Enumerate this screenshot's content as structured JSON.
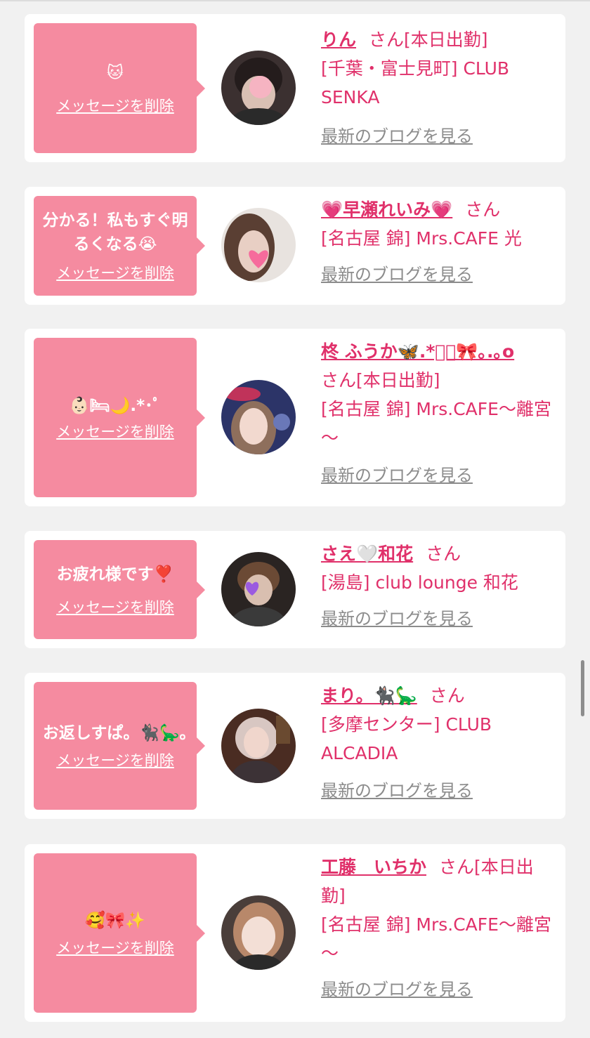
{
  "delete_label": "メッセージを削除",
  "blog_label": "最新のブログを見る",
  "colors": {
    "accent": "#e0306a",
    "bubble": "#f58ba0",
    "muted": "#8c8c8c",
    "background": "#f1f1f1"
  },
  "items": [
    {
      "message": "🐱",
      "name": "りん",
      "san": "さん[本日出勤]",
      "shop": "[千葉・富士見町] CLUB SENKA",
      "avatar_icon": "avatar-photo"
    },
    {
      "message": "分かる！私もすぐ明るくなる😭",
      "name": "💗早瀬れいみ💗",
      "san": "さん",
      "shop": "[名古屋 錦] Mrs.CAFE 光",
      "avatar_icon": "avatar-photo"
    },
    {
      "message": "👶🏻🛏🌙.*･ﾟ",
      "name": "柊 ふうか🦋.*ﾟ︵🎀｡.｡o",
      "san": "さん[本日出勤]",
      "shop": "[名古屋 錦] Mrs.CAFE～離宮～",
      "avatar_icon": "avatar-photo"
    },
    {
      "message": "お疲れ様です❣️",
      "name": "さえ🤍和花",
      "san": "さん",
      "shop": "[湯島] club lounge 和花",
      "avatar_icon": "avatar-photo"
    },
    {
      "message": "お返しすぱ。🐈‍⬛🦕｡",
      "name": "まり。🐈‍⬛🦕",
      "san": "さん",
      "shop": "[多摩センター] CLUB ALCADIA",
      "avatar_icon": "avatar-photo"
    },
    {
      "message": "🥰🎀✨",
      "name": "工藤　いちか",
      "san": "さん[本日出勤]",
      "shop": "[名古屋 錦] Mrs.CAFE～離宮～",
      "avatar_icon": "avatar-photo"
    }
  ]
}
